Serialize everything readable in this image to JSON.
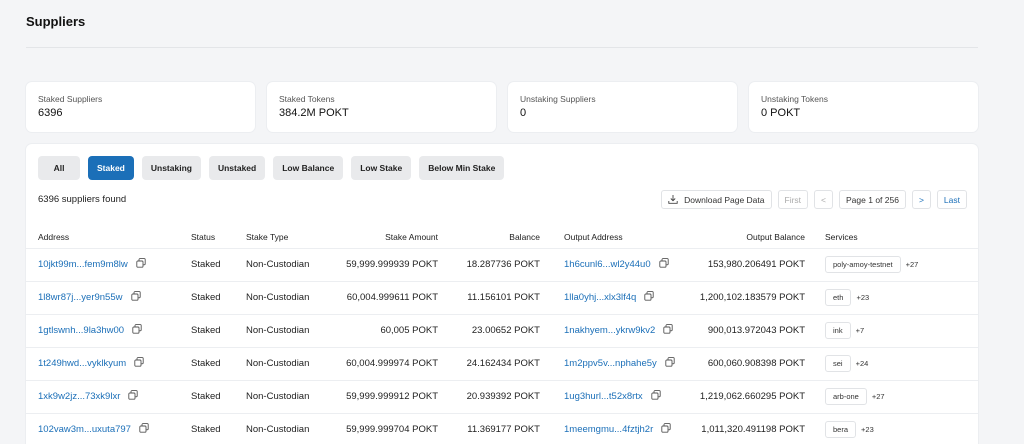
{
  "page": {
    "title": "Suppliers"
  },
  "stats": [
    {
      "label": "Staked Suppliers",
      "value": "6396"
    },
    {
      "label": "Staked Tokens",
      "value": "384.2M POKT"
    },
    {
      "label": "Unstaking Suppliers",
      "value": "0"
    },
    {
      "label": "Unstaking Tokens",
      "value": "0 POKT"
    }
  ],
  "filters": [
    {
      "label": "All",
      "active": false
    },
    {
      "label": "Staked",
      "active": true
    },
    {
      "label": "Unstaking",
      "active": false
    },
    {
      "label": "Unstaked",
      "active": false
    },
    {
      "label": "Low Balance",
      "active": false
    },
    {
      "label": "Low Stake",
      "active": false
    },
    {
      "label": "Below Min Stake",
      "active": false
    }
  ],
  "results": {
    "found_text": "6396 suppliers found"
  },
  "toolbar": {
    "download_label": "Download Page Data"
  },
  "pager": {
    "first": "First",
    "prev": "<",
    "page_info": "Page 1 of 256",
    "next": ">",
    "last": "Last"
  },
  "table": {
    "headers": [
      "Address",
      "Status",
      "Stake Type",
      "Stake Amount",
      "Balance",
      "Output Address",
      "Output Balance",
      "Services"
    ],
    "rows": [
      {
        "address": "10jkt99m...fem9m8lw",
        "status": "Staked",
        "type": "Non-Custodian",
        "amount": "59,999.999939 POKT",
        "balance": "18.287736 POKT",
        "output": "1h6cunl6...wl2y44u0",
        "output_balance": "153,980.206491 POKT",
        "service": "poly-amoy-testnet",
        "more": "+27"
      },
      {
        "address": "1l8wr87j...yer9n55w",
        "status": "Staked",
        "type": "Non-Custodian",
        "amount": "60,004.999611 POKT",
        "balance": "11.156101 POKT",
        "output": "1lla0yhj...xlx3lf4q",
        "output_balance": "1,200,102.183579 POKT",
        "service": "eth",
        "more": "+23"
      },
      {
        "address": "1gtlswnh...9la3hw00",
        "status": "Staked",
        "type": "Non-Custodian",
        "amount": "60,005 POKT",
        "balance": "23.00652 POKT",
        "output": "1nakhyem...ykrw9kv2",
        "output_balance": "900,013.972043 POKT",
        "service": "ink",
        "more": "+7"
      },
      {
        "address": "1t249hwd...vyklkyum",
        "status": "Staked",
        "type": "Non-Custodian",
        "amount": "60,004.999974 POKT",
        "balance": "24.162434 POKT",
        "output": "1m2ppv5v...nphahe5y",
        "output_balance": "600,060.908398 POKT",
        "service": "sei",
        "more": "+24"
      },
      {
        "address": "1xk9w2jz...73xk9lxr",
        "status": "Staked",
        "type": "Non-Custodian",
        "amount": "59,999.999912 POKT",
        "balance": "20.939392 POKT",
        "output": "1ug3hurl...t52x8rtx",
        "output_balance": "1,219,062.660295 POKT",
        "service": "arb-one",
        "more": "+27"
      },
      {
        "address": "102vaw3m...uxuta797",
        "status": "Staked",
        "type": "Non-Custodian",
        "amount": "59,999.999704 POKT",
        "balance": "11.369177 POKT",
        "output": "1meemgmu...4fztjh2r",
        "output_balance": "1,011,320.491198 POKT",
        "service": "bera",
        "more": "+23"
      }
    ]
  },
  "colors": {
    "accent": "#1b6fb8",
    "background": "#f4f5f7"
  }
}
